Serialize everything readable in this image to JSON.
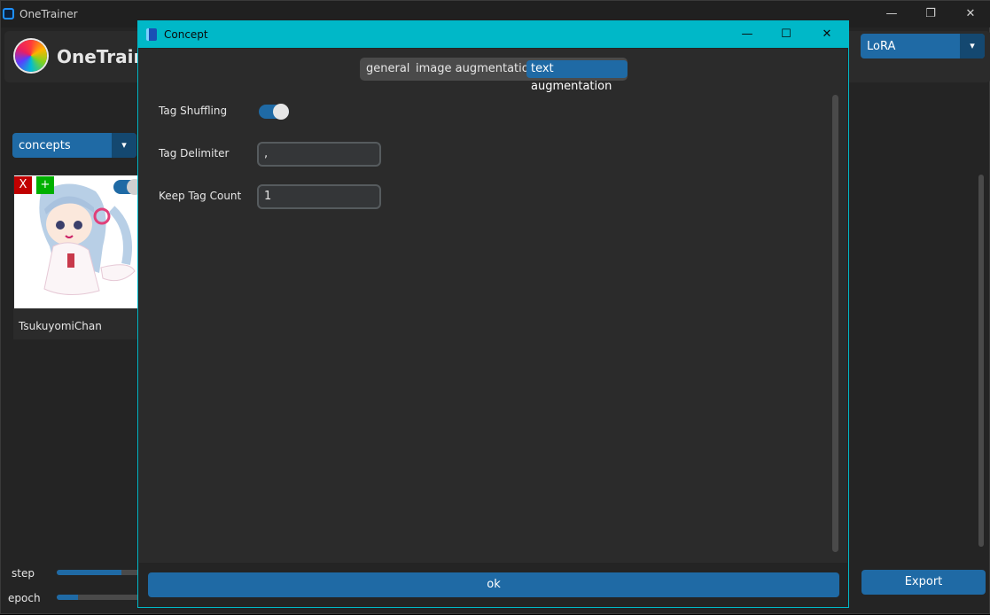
{
  "main_window": {
    "title": "OneTrainer",
    "app_name": "OneTrainer",
    "controls": {
      "minimize": "—",
      "restore": "❐",
      "close": "✕"
    },
    "model_type_dropdown": {
      "value": "LoRA"
    },
    "section_dropdown": {
      "value": "concepts"
    },
    "concept_card": {
      "name": "TsukuyomiChan",
      "remove_label": "X",
      "add_label": "+",
      "enabled": true
    },
    "progress": {
      "step_label": "step",
      "step_value": 0.75,
      "epoch_label": "epoch",
      "epoch_value": 0.25
    },
    "export_label": "Export"
  },
  "dialog": {
    "title": "Concept",
    "controls": {
      "minimize": "—",
      "maximize": "☐",
      "close": "✕"
    },
    "tabs": [
      {
        "label": "general",
        "active": false
      },
      {
        "label": "image augmentation",
        "active": false
      },
      {
        "label": "text augmentation",
        "active": true
      }
    ],
    "fields": {
      "tag_shuffling": {
        "label": "Tag Shuffling",
        "enabled": true
      },
      "tag_delimiter": {
        "label": "Tag Delimiter",
        "value": ","
      },
      "keep_tag_count": {
        "label": "Keep Tag Count",
        "value": "1"
      }
    },
    "ok_label": "ok"
  },
  "colors": {
    "accent": "#1f6aa5",
    "dialog_titlebar": "#00b8c8",
    "background": "#242424"
  }
}
